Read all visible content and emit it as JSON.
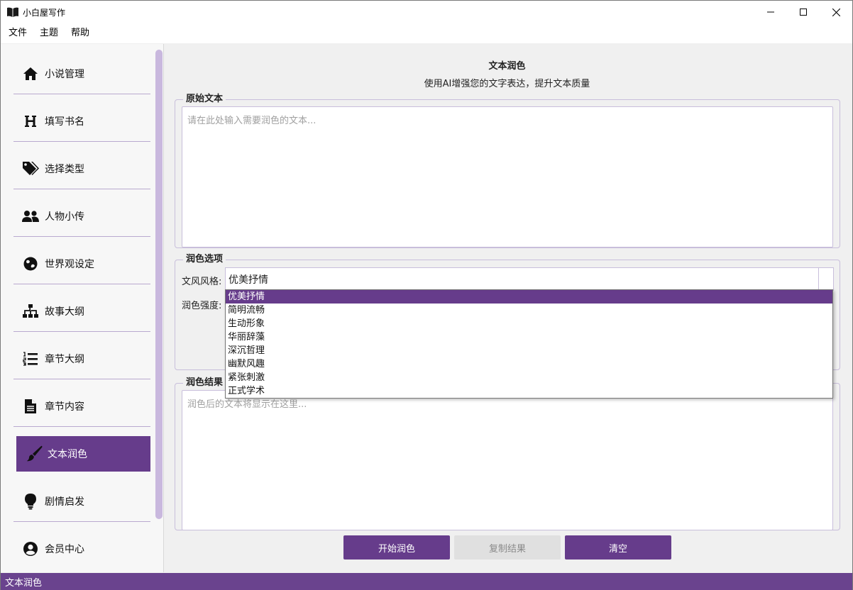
{
  "window": {
    "title": "小白屋写作"
  },
  "menu": [
    "文件",
    "主题",
    "帮助"
  ],
  "sidebar": {
    "items": [
      {
        "label": "小说管理",
        "icon": "home-icon"
      },
      {
        "label": "填写书名",
        "icon": "heading-icon"
      },
      {
        "label": "选择类型",
        "icon": "tags-icon"
      },
      {
        "label": "人物小传",
        "icon": "users-icon"
      },
      {
        "label": "世界观设定",
        "icon": "globe-icon"
      },
      {
        "label": "故事大纲",
        "icon": "sitemap-icon"
      },
      {
        "label": "章节大纲",
        "icon": "list-ol-icon"
      },
      {
        "label": "章节内容",
        "icon": "file-icon"
      },
      {
        "label": "文本润色",
        "icon": "paintbrush-icon",
        "active": true
      },
      {
        "label": "剧情启发",
        "icon": "lightbulb-icon"
      },
      {
        "label": "会员中心",
        "icon": "user-circle-icon"
      }
    ]
  },
  "main": {
    "title": "文本润色",
    "subtitle": "使用AI增强您的文字表达，提升文本质量",
    "original": {
      "group_title": "原始文本",
      "placeholder": "请在此处输入需要润色的文本..."
    },
    "options": {
      "group_title": "润色选项",
      "style_label": "文风风格:",
      "style_value": "优美抒情",
      "strength_label": "润色强度:",
      "style_options": [
        "优美抒情",
        "简明流畅",
        "生动形象",
        "华丽辞藻",
        "深沉哲理",
        "幽默风趣",
        "紧张刺激",
        "正式学术"
      ]
    },
    "result": {
      "group_title": "润色结果",
      "placeholder": "润色后的文本将显示在这里..."
    },
    "buttons": {
      "start": "开始润色",
      "copy": "复制结果",
      "clear": "清空"
    }
  },
  "status": {
    "text": "文本润色"
  },
  "colors": {
    "accent": "#663c8b",
    "status_bar": "#6a438e",
    "border": "#c8bedb"
  }
}
